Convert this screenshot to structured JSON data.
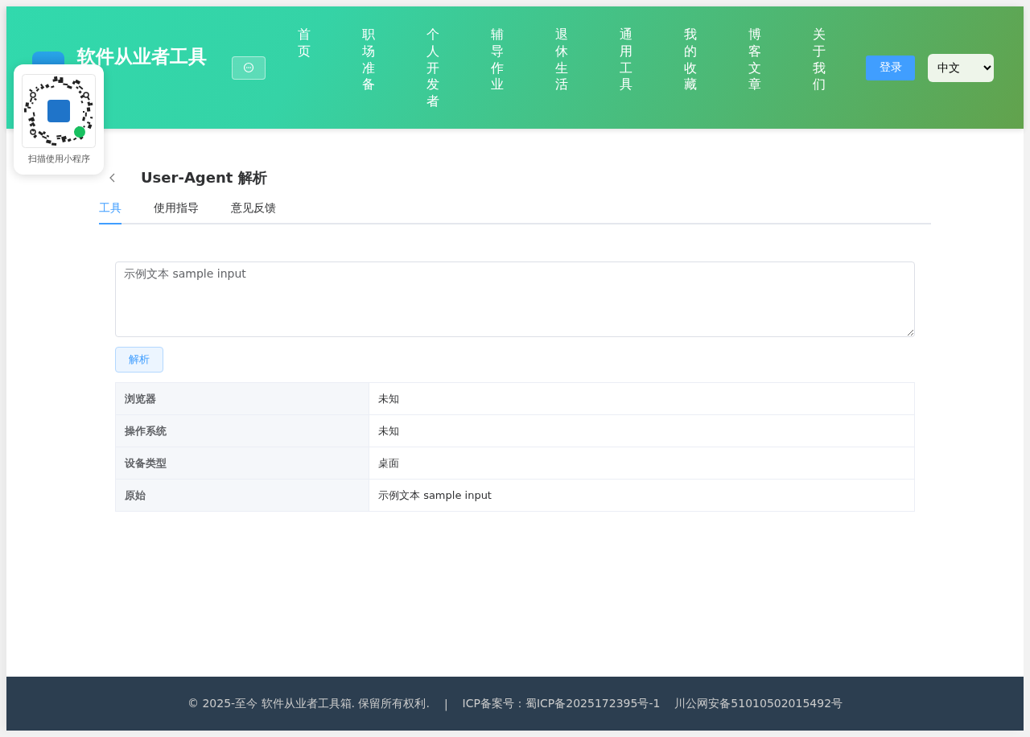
{
  "header": {
    "title": "软件从业者工具",
    "nav": [
      {
        "label": "首页"
      },
      {
        "label": "职场准备"
      },
      {
        "label": "个人开发者"
      },
      {
        "label": "辅导作业"
      },
      {
        "label": "退休生活"
      },
      {
        "label": "通用工具"
      },
      {
        "label": "我的收藏"
      },
      {
        "label": "博客文章"
      },
      {
        "label": "关于我们"
      }
    ],
    "login": "登录",
    "language": "中文"
  },
  "qr_popup": {
    "caption": "扫描使用小程序"
  },
  "page": {
    "title": "User-Agent 解析",
    "tabs": [
      {
        "label": "工具",
        "selected": true
      },
      {
        "label": "使用指导",
        "selected": false
      },
      {
        "label": "意见反馈",
        "selected": false
      }
    ],
    "input": "示例文本 sample input",
    "button": "解析",
    "results": [
      {
        "label": "浏览器",
        "value": "未知"
      },
      {
        "label": "操作系统",
        "value": "未知"
      },
      {
        "label": "设备类型",
        "value": "桌面"
      },
      {
        "label": "原始",
        "value": "示例文本 sample input"
      }
    ]
  },
  "footer": {
    "copyright": "© 2025-至今 软件从业者工具箱. 保留所有权利.",
    "separator": "|",
    "icp": "ICP备案号：蜀ICP备2025172395号-1",
    "police": "川公网安备51010502015492号"
  }
}
